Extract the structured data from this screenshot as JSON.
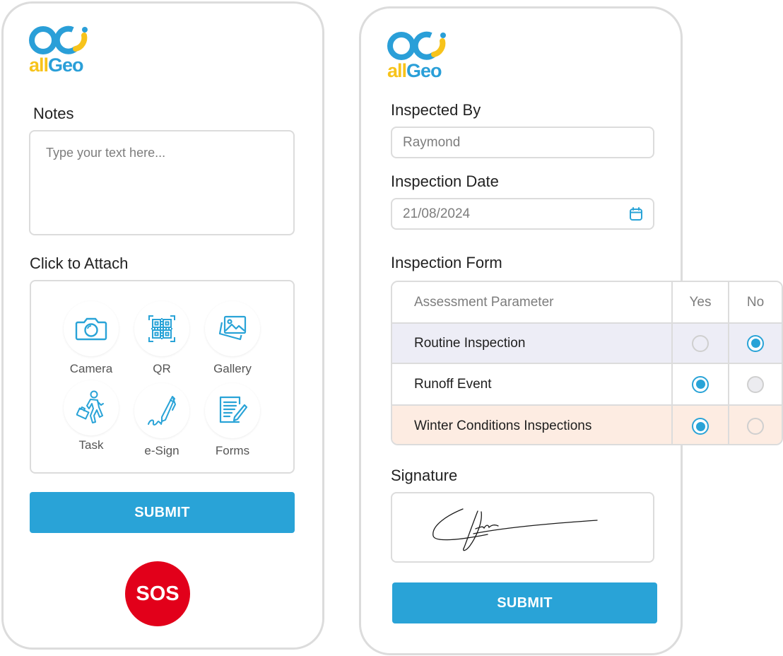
{
  "brand": {
    "logo_text_part1": "all",
    "logo_text_part2": "Geo",
    "colors": {
      "blue": "#2a9fd8",
      "yellow": "#f7c31b"
    }
  },
  "left_panel": {
    "notes_label": "Notes",
    "notes_placeholder": "Type your text here...",
    "attach_label": "Click to Attach",
    "attach_items": [
      {
        "label": "Camera",
        "icon": "camera-icon"
      },
      {
        "label": "QR",
        "icon": "qr-code-icon"
      },
      {
        "label": "Gallery",
        "icon": "gallery-icon"
      },
      {
        "label": "Task",
        "icon": "task-walking-person-icon"
      },
      {
        "label": "e-Sign",
        "icon": "pen-signature-icon"
      },
      {
        "label": "Forms",
        "icon": "form-document-icon"
      }
    ],
    "submit_label": "SUBMIT",
    "sos_label": "SOS"
  },
  "right_panel": {
    "inspected_by_label": "Inspected By",
    "inspected_by_value": "Raymond",
    "inspection_date_label": "Inspection Date",
    "inspection_date_value": "21/08/2024",
    "inspection_form_label": "Inspection Form",
    "table": {
      "headers": [
        "Assessment Parameter",
        "Yes",
        "No"
      ],
      "rows": [
        {
          "parameter": "Routine Inspection",
          "selected": "No",
          "highlight": "#ededf6"
        },
        {
          "parameter": "Runoff Event",
          "selected": "Yes",
          "highlight": "#ffffff"
        },
        {
          "parameter": "Winter Conditions Inspections",
          "selected": "Yes",
          "highlight": "#fdece2"
        }
      ]
    },
    "signature_label": "Signature",
    "submit_label": "SUBMIT"
  },
  "colors": {
    "accent": "#29a3d7",
    "sos": "#e2001a",
    "border": "#dcdcdc"
  }
}
